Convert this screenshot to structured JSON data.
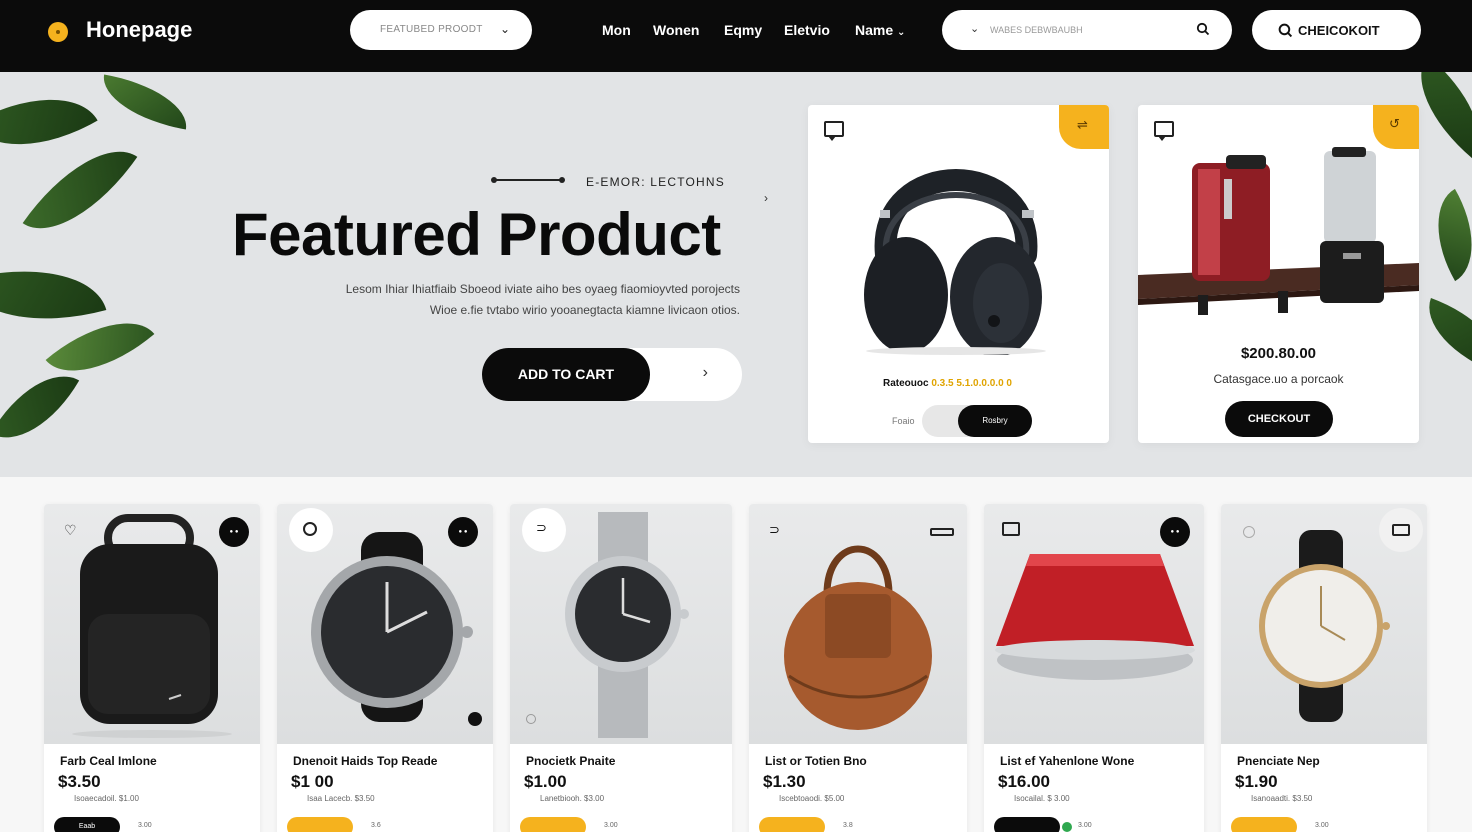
{
  "brand": {
    "name": "Honepage"
  },
  "nav": {
    "category_select": {
      "placeholder": "FEATUBED PROODT"
    },
    "links": [
      "Mon",
      "Wonen",
      "Eqmy",
      "Eletvio",
      "Name"
    ],
    "search": {
      "placeholder": "WABES DEBWBAUBH"
    },
    "checkout_label": "CHEICOKOIT"
  },
  "hero": {
    "eyebrow": "E-EMOR: LECTOHNS",
    "title": "Featured Product",
    "description_line1": "Lesom Ihiar Ihiatfiaib Sboeod iviate aiho bes oyaeg fiaomioyvted porojects",
    "description_line2": "Wioe e.fie tvtabo wirio yooanegtacta kiamne livicaon otios.",
    "cta_label": "ADD TO CART"
  },
  "featured_cards": [
    {
      "product": "headphones",
      "label": "Rateouoc",
      "label_highlight": "0.3.5 5.1.0.0.0.0 0",
      "toggle_left": "Foaio",
      "toggle_right": "Rosbry",
      "accent": "#f5b21e"
    },
    {
      "product": "kitchen-appliances",
      "price": "$200.80.00",
      "caption": "Catasgace.uo a porcaok",
      "button": "CHECKOUT",
      "accent": "#f5b21e"
    }
  ],
  "products": [
    {
      "name": "Farb Ceal Imlone",
      "price": "$3.50",
      "sub": "Isoaecadoil. $1.00",
      "button_color": "#0b0b0b",
      "button_label": "Eaab",
      "extra": "3.00"
    },
    {
      "name": "Dnenoit Haids Top Reade",
      "price": "$1 00",
      "sub": "Isaa Lacecb. $3.50",
      "button_color": "#f5b21e",
      "button_label": "",
      "extra": "3.6"
    },
    {
      "name": "Pnocietk Pnaite",
      "price": "$1.00",
      "sub": "Lanetbiooh. $3.00",
      "button_color": "#f5b21e",
      "button_label": "",
      "extra": "3.00"
    },
    {
      "name": "List or Totien Bno",
      "price": "$1.30",
      "sub": "Iscebtoaodi. $5.00",
      "button_color": "#f5b21e",
      "button_label": "",
      "extra": "3.8"
    },
    {
      "name": "List ef Yahenlone Wone",
      "price": "$16.00",
      "sub": "Isocailal. $ 3.00",
      "button_color": "#0b0b0b",
      "button_label": "",
      "extra": "3.00"
    },
    {
      "name": "Pnenciate Nep",
      "price": "$1.90",
      "sub": "Isanoaadti. $3.50",
      "button_color": "#f5b21e",
      "button_label": "",
      "extra": "3.00"
    }
  ],
  "colors": {
    "accent": "#f5b21e",
    "dark": "#0b0b0b",
    "hero_bg": "#e2e4e6"
  }
}
